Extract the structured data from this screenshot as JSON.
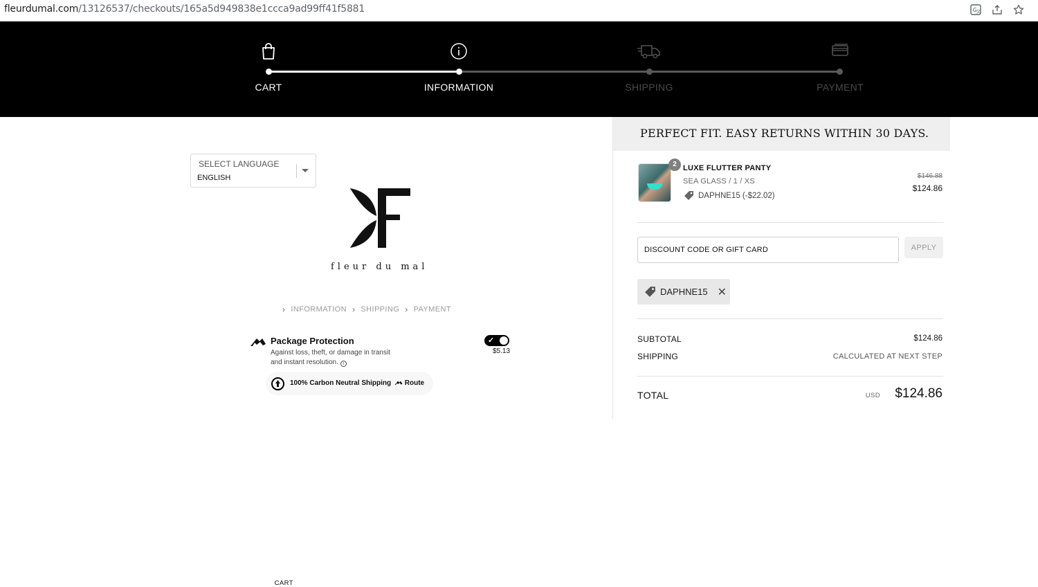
{
  "browser": {
    "url_domain": "fleurdumal.com",
    "url_path": "/13126537/checkouts/165a5d949838e1ccca9ad99ff41f5881",
    "icons": [
      "translate-icon",
      "share-icon",
      "star-icon"
    ]
  },
  "progress": {
    "steps": [
      {
        "label": "CART",
        "icon": "bag-icon",
        "state": "complete",
        "color": "#ffffff"
      },
      {
        "label": "INFORMATION",
        "icon": "info-icon",
        "state": "current",
        "color": "#ffffff"
      },
      {
        "label": "SHIPPING",
        "icon": "truck-icon",
        "state": "upcoming",
        "color": "#4a4a4a"
      },
      {
        "label": "PAYMENT",
        "icon": "card-icon",
        "state": "upcoming",
        "color": "#4a4a4a"
      }
    ]
  },
  "language": {
    "label": "SELECT LANGUAGE",
    "value": "ENGLISH"
  },
  "brand": {
    "wordmark": "fleur du mal"
  },
  "breadcrumb": {
    "items": [
      "CART",
      "INFORMATION",
      "SHIPPING",
      "PAYMENT"
    ]
  },
  "package_protection": {
    "title": "Package Protection",
    "description_line1": "Against loss, theft, or damage in transit",
    "description_line2": "and instant resolution.",
    "price": "$5.13",
    "enabled": true,
    "carbon_text": "100% Carbon Neutral Shipping",
    "provider": "Route"
  },
  "order": {
    "banner": "PERFECT FIT. EASY RETURNS WITHIN 30 DAYS.",
    "item": {
      "quantity": "2",
      "name": "LUXE FLUTTER PANTY",
      "variant": "SEA GLASS / 1 / XS",
      "discount": "DAPHNE15 (-$22.02)",
      "original_price": "$146.88",
      "price": "$124.86"
    },
    "discount_input": {
      "placeholder": "DISCOUNT CODE OR GIFT CARD",
      "apply_label": "APPLY"
    },
    "applied_code": "DAPHNE15",
    "subtotal_label": "SUBTOTAL",
    "subtotal_value": "$124.86",
    "shipping_label": "SHIPPING",
    "shipping_value": "CALCULATED AT NEXT STEP",
    "total_label": "TOTAL",
    "currency": "USD",
    "total_value": "$124.86"
  }
}
